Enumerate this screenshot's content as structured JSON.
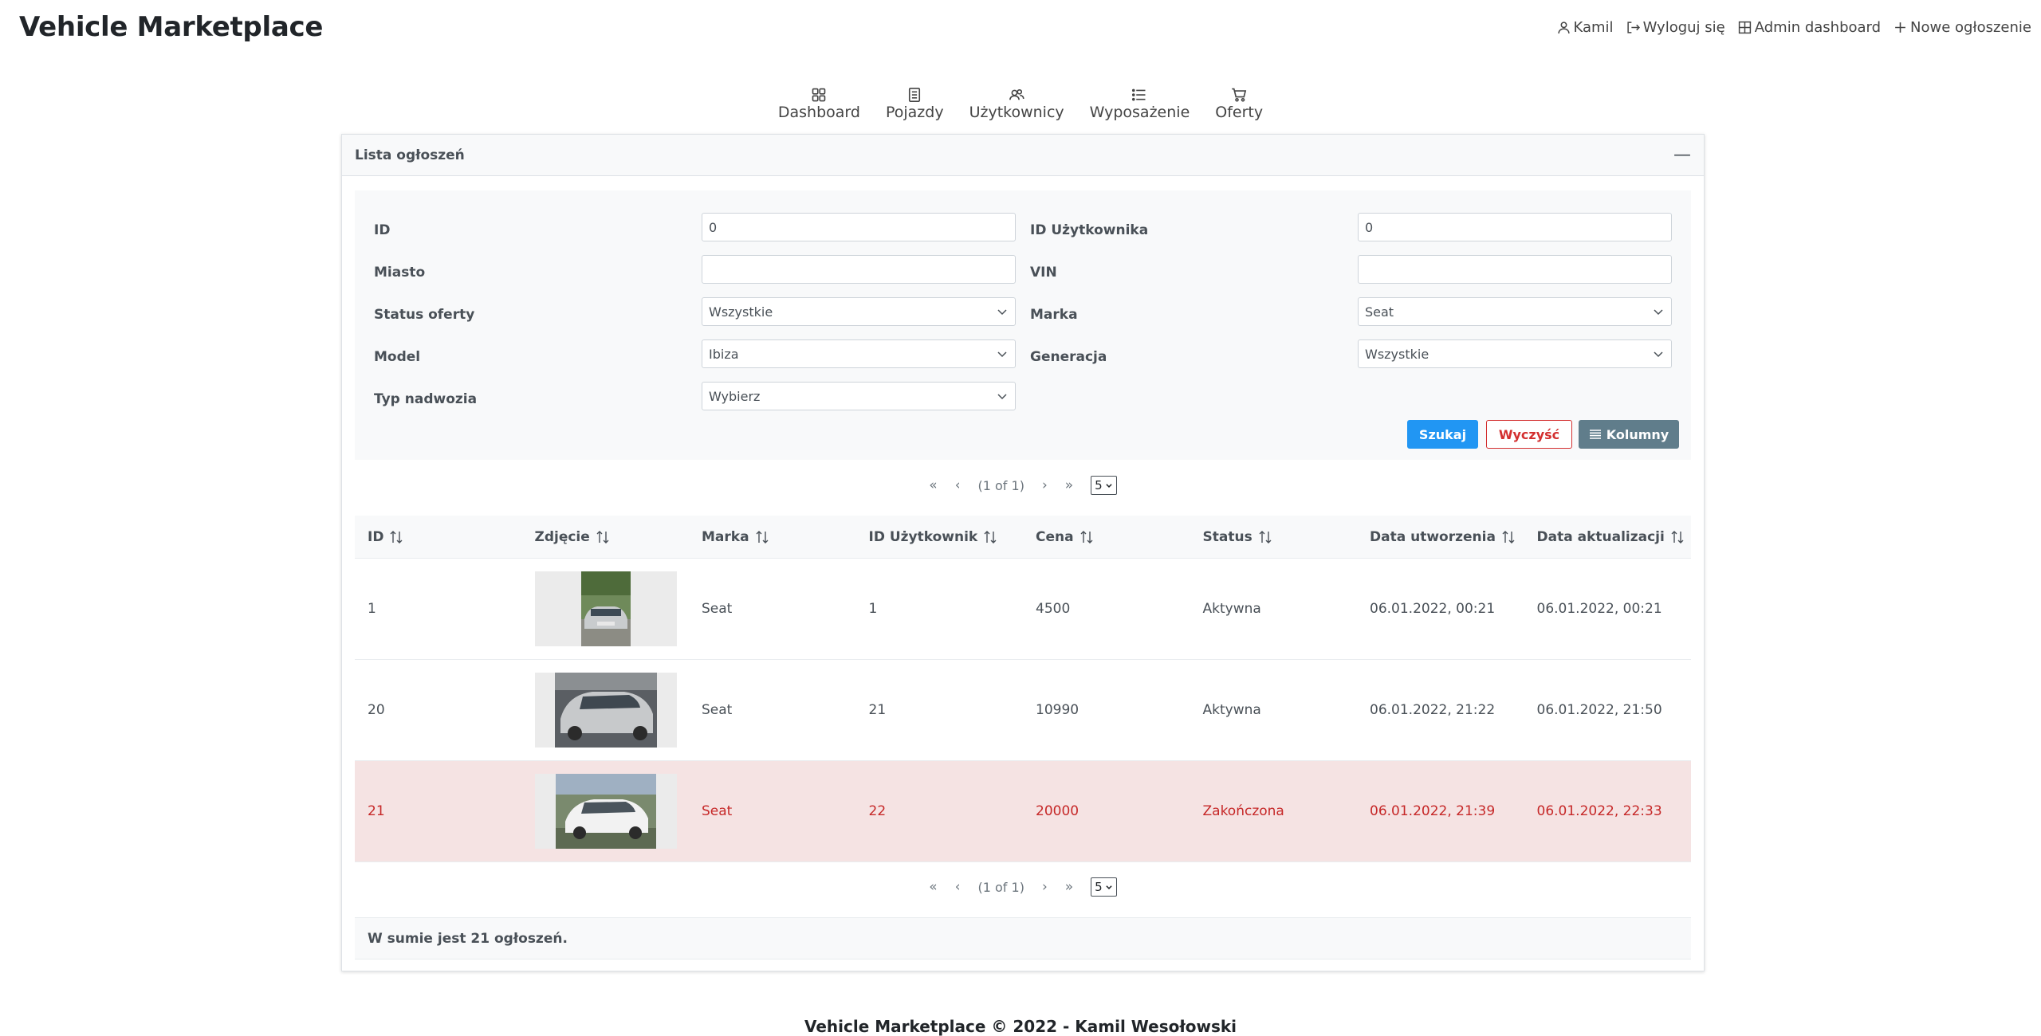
{
  "app": {
    "title": "Vehicle Marketplace"
  },
  "topnav": {
    "user": "Kamil",
    "logout": "Wyloguj się",
    "admin": "Admin dashboard",
    "new_offer": "Nowe ogłoszenie"
  },
  "mainnav": {
    "items": [
      {
        "label": "Dashboard",
        "icon": "grid-icon"
      },
      {
        "label": "Pojazdy",
        "icon": "document-icon"
      },
      {
        "label": "Użytkownicy",
        "icon": "users-icon"
      },
      {
        "label": "Wyposażenie",
        "icon": "list-icon"
      },
      {
        "label": "Oferty",
        "icon": "cart-icon"
      }
    ]
  },
  "panel": {
    "title": "Lista ogłoszeń"
  },
  "filters": {
    "id_label": "ID",
    "id_value": "0",
    "user_id_label": "ID Użytkownika",
    "user_id_value": "0",
    "city_label": "Miasto",
    "city_value": "",
    "vin_label": "VIN",
    "vin_value": "",
    "status_label": "Status oferty",
    "status_value": "Wszystkie",
    "brand_label": "Marka",
    "brand_value": "Seat",
    "model_label": "Model",
    "model_value": "Ibiza",
    "generation_label": "Generacja",
    "generation_value": "Wszystkie",
    "body_label": "Typ nadwozia",
    "body_value": "Wybierz",
    "search_btn": "Szukaj",
    "clear_btn": "Wyczyść",
    "columns_btn": "Kolumny"
  },
  "paginator": {
    "report": "(1 of 1)",
    "rows": "5"
  },
  "table": {
    "headers": [
      "ID",
      "Zdjęcie",
      "Marka",
      "ID Użytkownik",
      "Cena",
      "Status",
      "Data utworzenia",
      "Data aktualizacji"
    ],
    "rows": [
      {
        "id": "1",
        "brand": "Seat",
        "user_id": "1",
        "price": "4500",
        "status": "Aktywna",
        "created": "06.01.2022, 00:21",
        "updated": "06.01.2022, 00:21",
        "ended": false
      },
      {
        "id": "20",
        "brand": "Seat",
        "user_id": "21",
        "price": "10990",
        "status": "Aktywna",
        "created": "06.01.2022, 21:22",
        "updated": "06.01.2022, 21:50",
        "ended": false
      },
      {
        "id": "21",
        "brand": "Seat",
        "user_id": "22",
        "price": "20000",
        "status": "Zakończona",
        "created": "06.01.2022, 21:39",
        "updated": "06.01.2022, 22:33",
        "ended": true
      }
    ]
  },
  "summary": "W sumie jest 21 ogłoszeń.",
  "footer": "Vehicle Marketplace © 2022 - Kamil Wesołowski",
  "colors": {
    "primary": "#2196f3",
    "danger": "#d32f2f",
    "secondary": "#607d8b",
    "ended_row": "#f5e3e3"
  }
}
